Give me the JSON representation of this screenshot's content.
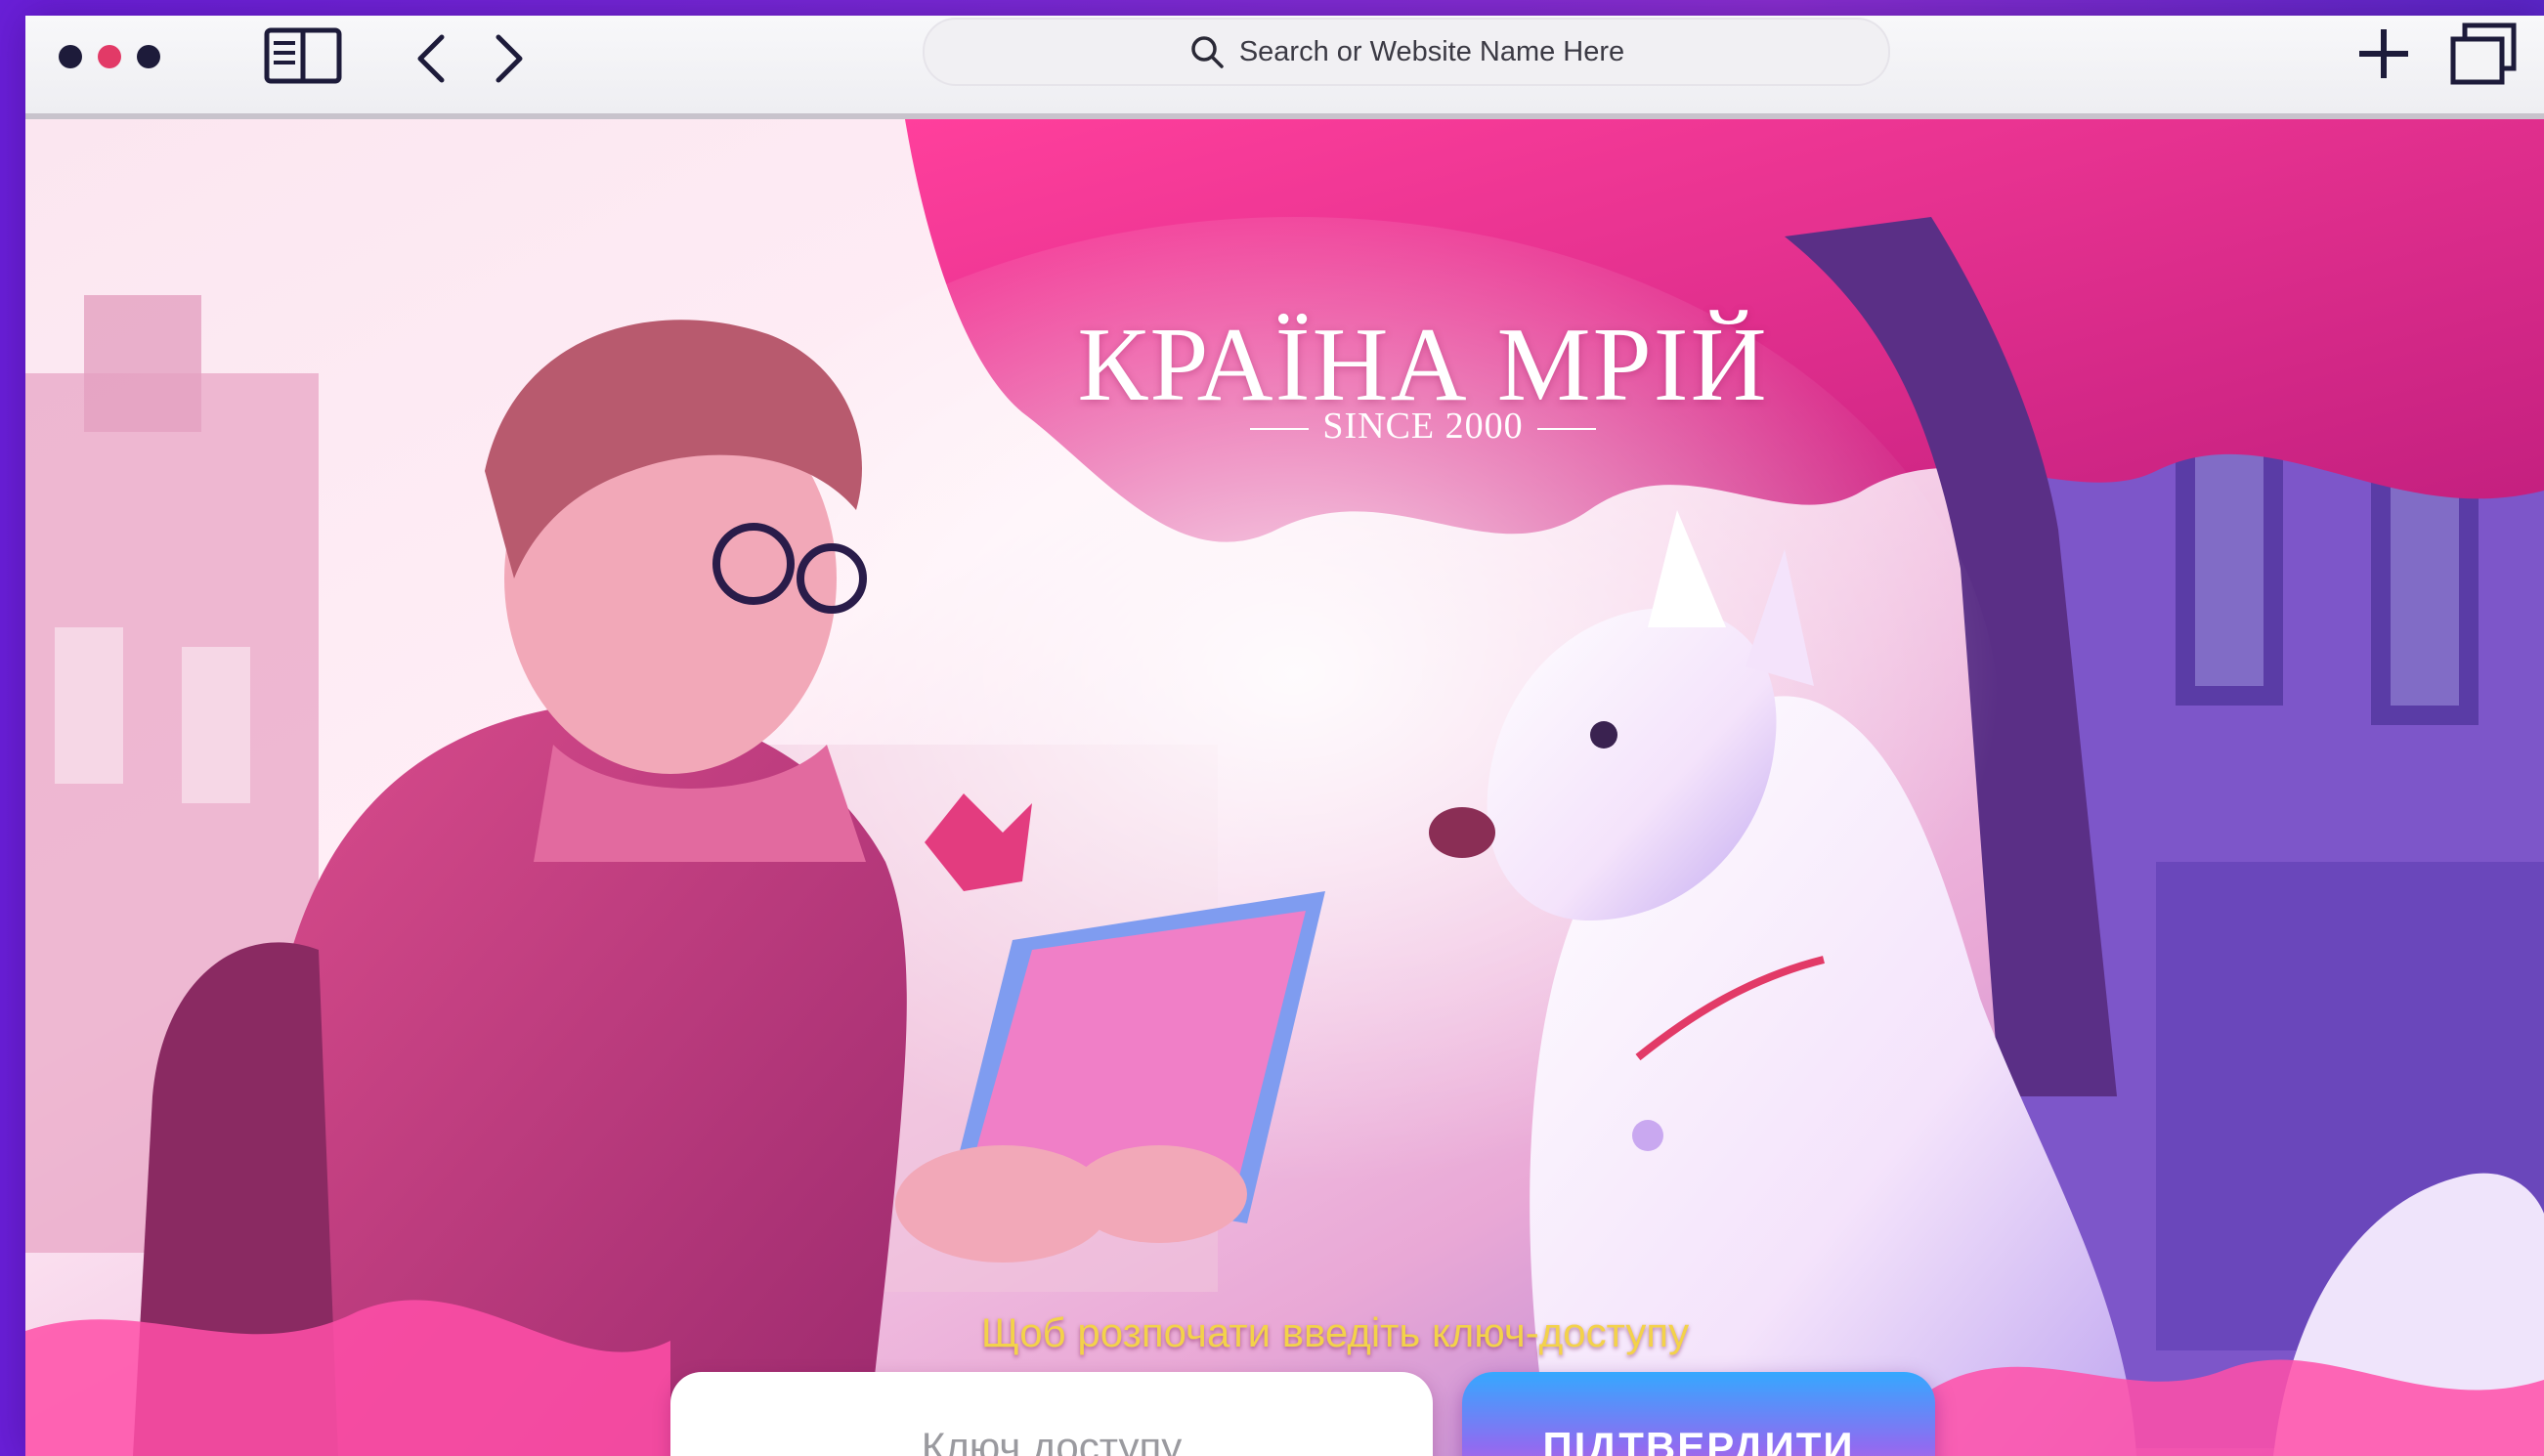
{
  "browser": {
    "address_placeholder": "Search or Website Name Here",
    "icons": [
      "sidebar-icon",
      "back-icon",
      "forward-icon",
      "search-icon",
      "new-tab-icon",
      "tabs-icon"
    ],
    "dots": [
      "#1d1b3a",
      "#e23a67",
      "#1d1b3a"
    ]
  },
  "hero": {
    "title": "КРАЇНА МРІЙ",
    "subtitle": "SINCE 2000"
  },
  "login": {
    "prompt": "Щоб розпочати введіть ключ-доступу",
    "key_placeholder": "Ключ доступу",
    "confirm_label": "ПІДТВЕРДИТИ"
  },
  "colors": {
    "frame": "#7b2ad6",
    "accent_pink": "#ff4fa8",
    "prompt_yellow": "#f3d24a",
    "button_blue": "#35a8ff"
  }
}
